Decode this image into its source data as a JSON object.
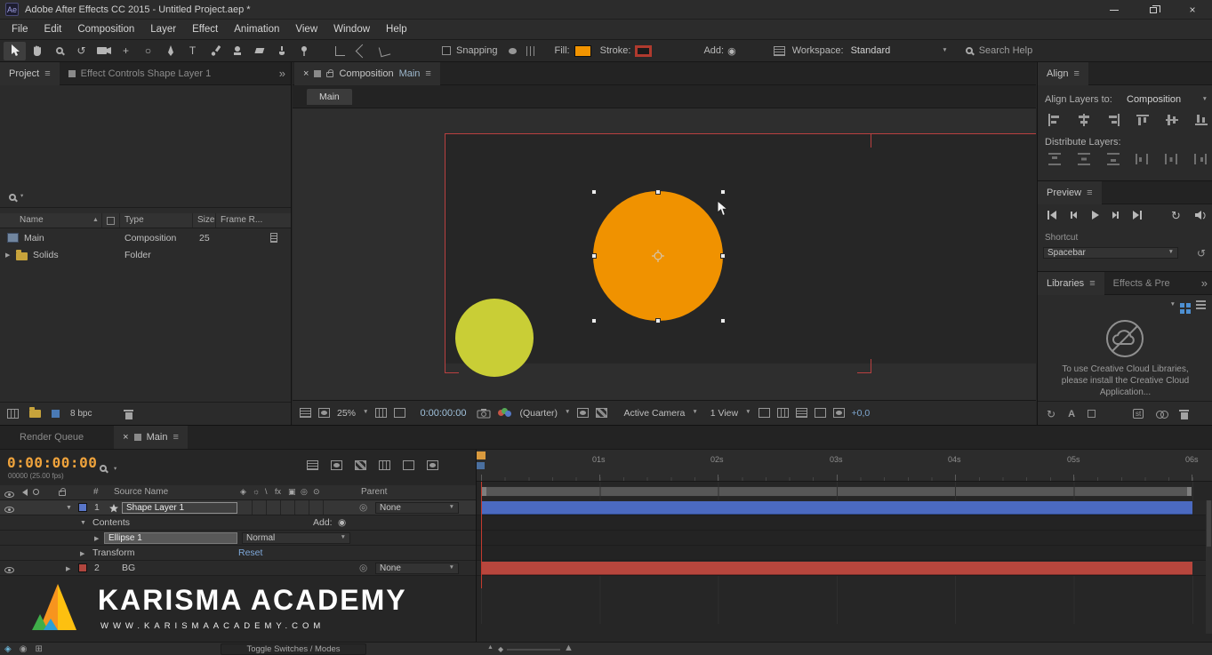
{
  "glyphs": {
    "menu": "≡",
    "close": "×",
    "overflow": "»",
    "caret_down": "▼",
    "caret_right": "▶",
    "caret_small": "▾",
    "sort_asc": "▲",
    "add_circle": "◉",
    "pickwhip": "◎",
    "loop": "↻",
    "reset_icon": "↺",
    "rotate_tool": "↺",
    "pan_tool": "+",
    "ellipse_tool": "○",
    "type_tool": "T",
    "diamond": "◆",
    "mountain": "▲"
  },
  "colors": {
    "fill_swatch": "#f29400",
    "stroke_swatch": "#b03a2e",
    "shape_orange": "#f09200",
    "shape_yellow": "#c9ce36",
    "layer_bar_blue": "#4b6ac0",
    "layer_bar_red": "#b7463d",
    "timecode_orange": "#efa33c"
  },
  "titlebar": {
    "app_initials": "Ae",
    "title": "Adobe After Effects CC 2015 - Untitled Project.aep *"
  },
  "menubar": {
    "items": [
      "File",
      "Edit",
      "Composition",
      "Layer",
      "Effect",
      "Animation",
      "View",
      "Window",
      "Help"
    ]
  },
  "toolbar": {
    "snapping": "Snapping",
    "fill_label": "Fill:",
    "stroke_label": "Stroke:",
    "add_label": "Add:",
    "workspace_label": "Workspace:",
    "workspace_value": "Standard",
    "search_help": "Search Help"
  },
  "project": {
    "tab": "Project",
    "tab_effect_controls": "Effect Controls Shape Layer 1",
    "col_name": "Name",
    "col_type": "Type",
    "col_size": "Size",
    "col_frame": "Frame R...",
    "rows": [
      {
        "name": "Main",
        "type": "Composition",
        "frame_rate": "25"
      },
      {
        "name": "Solids",
        "type": "Folder",
        "frame_rate": ""
      }
    ],
    "color_depth": "8 bpc"
  },
  "comp": {
    "tab_label": "Composition",
    "tab_comp_name": "Main",
    "viewer_tab": "Main",
    "zoom": "25%",
    "timecode": "0:00:00:00",
    "resolution": "(Quarter)",
    "camera": "Active Camera",
    "view_layout": "1 View",
    "exposure": "+0,0"
  },
  "align": {
    "title": "Align",
    "align_to_label": "Align Layers to:",
    "align_to_value": "Composition",
    "distribute_label": "Distribute Layers:"
  },
  "preview": {
    "title": "Preview",
    "shortcut_label": "Shortcut",
    "shortcut_value": "Spacebar"
  },
  "libraries": {
    "tab": "Libraries",
    "tab_effects": "Effects & Pre",
    "message_1": "To use Creative Cloud Libraries,",
    "message_2": "please install the Creative Cloud",
    "message_3": "Application...",
    "stock_badge": "st"
  },
  "timeline": {
    "tab_render_queue": "Render Queue",
    "tab_main": "Main",
    "timecode": "0:00:00:00",
    "frame_info": "00000 (25.00 fps)",
    "col_number": "#",
    "col_source_name": "Source Name",
    "col_parent": "Parent",
    "switch_icons": [
      "◈",
      "☼",
      "\\",
      "fx",
      "▣",
      "◎",
      "⊙"
    ],
    "layers": [
      {
        "index": "1",
        "name": "Shape Layer 1",
        "parent": "None"
      },
      {
        "index": "2",
        "name": "BG",
        "parent": "None"
      }
    ],
    "contents": "Contents",
    "add_label": "Add:",
    "ellipse": "Ellipse 1",
    "blend_mode": "Normal",
    "transform": "Transform",
    "reset": "Reset",
    "ticks": [
      "01s",
      "02s",
      "03s",
      "04s",
      "05s",
      "06s"
    ],
    "toggle_modes": "Toggle Switches / Modes"
  },
  "watermark": {
    "title": "KARISMA ACADEMY",
    "url": "WWW.KARISMAACADEMY.COM"
  }
}
